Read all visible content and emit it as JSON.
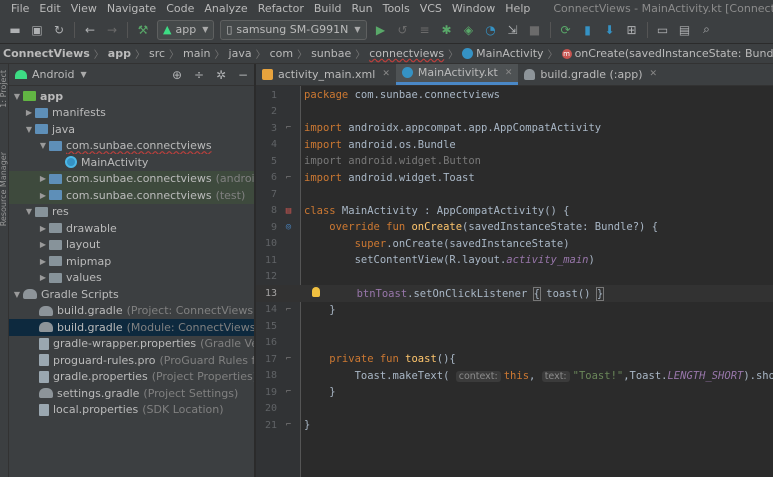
{
  "menu": {
    "items": [
      "File",
      "Edit",
      "View",
      "Navigate",
      "Code",
      "Analyze",
      "Refactor",
      "Build",
      "Run",
      "Tools",
      "VCS",
      "Window",
      "Help"
    ],
    "window_title": "ConnectViews - MainActivity.kt [ConnectViews.app] - Android"
  },
  "toolbar": {
    "config_label": "app",
    "device_label": "samsung SM-G991N"
  },
  "breadcrumb": {
    "items": [
      "ConnectViews",
      "app",
      "src",
      "main",
      "java",
      "com",
      "sunbae",
      "connectviews",
      "MainActivity",
      "onCreate(savedInstanceState: Bundle?)"
    ]
  },
  "toolstrip": {
    "project_label": "1: Project",
    "resource_label": "Resource Manager"
  },
  "project_panel": {
    "title": "Android",
    "tree": [
      {
        "label": "app",
        "extra": ""
      },
      {
        "label": "manifests",
        "extra": ""
      },
      {
        "label": "java",
        "extra": ""
      },
      {
        "label": "com.sunbae.connectviews",
        "extra": ""
      },
      {
        "label": "MainActivity",
        "extra": ""
      },
      {
        "label": "com.sunbae.connectviews",
        "extra": "(androidTest)"
      },
      {
        "label": "com.sunbae.connectviews",
        "extra": "(test)"
      },
      {
        "label": "res",
        "extra": ""
      },
      {
        "label": "drawable",
        "extra": ""
      },
      {
        "label": "layout",
        "extra": ""
      },
      {
        "label": "mipmap",
        "extra": ""
      },
      {
        "label": "values",
        "extra": ""
      },
      {
        "label": "Gradle Scripts",
        "extra": ""
      },
      {
        "label": "build.gradle",
        "extra": "(Project: ConnectViews)"
      },
      {
        "label": "build.gradle",
        "extra": "(Module: ConnectViews.app)"
      },
      {
        "label": "gradle-wrapper.properties",
        "extra": "(Gradle Version)"
      },
      {
        "label": "proguard-rules.pro",
        "extra": "(ProGuard Rules for Conn"
      },
      {
        "label": "gradle.properties",
        "extra": "(Project Properties)"
      },
      {
        "label": "settings.gradle",
        "extra": "(Project Settings)"
      },
      {
        "label": "local.properties",
        "extra": "(SDK Location)"
      }
    ]
  },
  "tabs": [
    {
      "label": "activity_main.xml",
      "color": "#e8a33d"
    },
    {
      "label": "MainActivity.kt",
      "color": "#3592c4"
    },
    {
      "label": "build.gradle (:app)",
      "color": "#8d9499"
    }
  ],
  "editor": {
    "line_numbers": [
      "1",
      "2",
      "3",
      "4",
      "5",
      "6",
      "7",
      "8",
      "9",
      "10",
      "11",
      "12",
      "13",
      "14",
      "15",
      "16",
      "17",
      "18",
      "19",
      "20",
      "21"
    ],
    "code": {
      "l1_kw": "package",
      "l1_rest": " com.sunbae.connectviews",
      "l3_kw": "import",
      "l3_rest": " androidx.appcompat.app.AppCompatActivity",
      "l4_kw": "import",
      "l4_rest": " android.os.Bundle",
      "l5": "import android.widget.Button",
      "l6_kw": "import",
      "l6_rest": " android.widget.Toast",
      "l8_kw": "class",
      "l8_rest": " MainActivity : AppCompatActivity() {",
      "l9_kw": "    override fun ",
      "l9_fn": "onCreate",
      "l9_rest": "(savedInstanceState: Bundle?) {",
      "l10_kw": "        super",
      "l10_rest": ".onCreate(savedInstanceState)",
      "l11_a": "        setContentView(R.layout.",
      "l11_prop": "activity_main",
      "l11_b": ")",
      "l13_a": "        ",
      "l13_prop": "btnToast",
      "l13_b": ".setOnClickListener ",
      "l13_brace_open": "{",
      "l13_c": " toast() ",
      "l13_brace_close": "}",
      "l14": "    }",
      "l17_kw": "    private fun ",
      "l17_fn": "toast",
      "l17_rest": "(){",
      "l18_a": "        Toast.makeText( ",
      "l18_hint1": "context:",
      "l18_this": "this",
      "l18_comma": ", ",
      "l18_hint2": "text:",
      "l18_str": "\"Toast!\"",
      "l18_b": ",Toast.",
      "l18_prop": "LENGTH_SHORT",
      "l18_c": ").show()",
      "l19": "    }",
      "l21": "}"
    }
  }
}
